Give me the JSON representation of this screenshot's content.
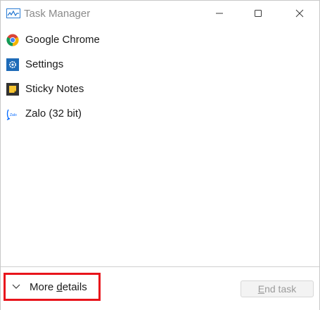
{
  "window": {
    "title": "Task Manager",
    "controls": {
      "minimize_icon": "minimize-icon",
      "maximize_icon": "maximize-icon",
      "close_icon": "close-icon"
    }
  },
  "processes": [
    {
      "label": "Google Chrome",
      "icon": "chrome-icon"
    },
    {
      "label": "Settings",
      "icon": "settings-gear-icon"
    },
    {
      "label": "Sticky Notes",
      "icon": "sticky-notes-icon"
    },
    {
      "label": "Zalo (32 bit)",
      "icon": "zalo-icon",
      "icon_text": "Zalo"
    }
  ],
  "footer": {
    "more_details_prefix": "More ",
    "more_details_underlined": "d",
    "more_details_suffix": "etails",
    "end_task_underlined": "E",
    "end_task_suffix": "nd task"
  },
  "colors": {
    "highlight_border": "#e8141b",
    "title_text": "#8a8a8a",
    "disabled_text": "#9b9b9b"
  }
}
